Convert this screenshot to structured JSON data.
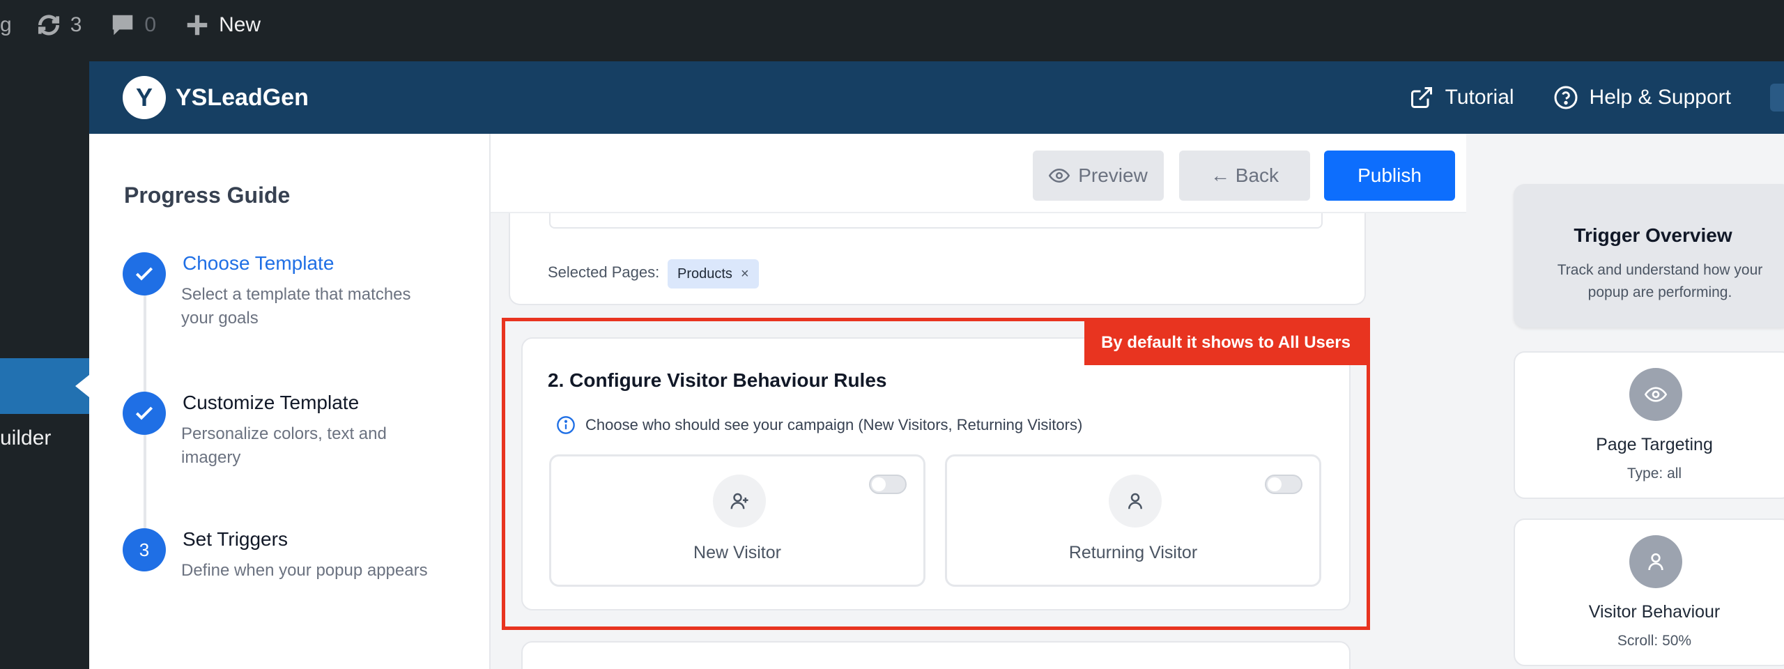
{
  "adminbar": {
    "site_fragment": "g",
    "updates_count": "3",
    "comments_count": "0",
    "new_label": "New"
  },
  "wpmenu": {
    "partial_label": "uilder"
  },
  "header": {
    "logo_letter": "Y",
    "brand": "YSLeadGen",
    "tutorial": "Tutorial",
    "help": "Help & Support"
  },
  "guide": {
    "title": "Progress Guide",
    "steps": [
      {
        "title": "Choose Template",
        "desc": "Select a template that matches your goals"
      },
      {
        "title": "Customize Template",
        "desc": "Personalize colors, text and imagery"
      },
      {
        "number": "3",
        "title": "Set Triggers",
        "desc": "Define when your popup appears"
      }
    ]
  },
  "toolbar": {
    "preview": "Preview",
    "back": "← Back",
    "publish": "Publish"
  },
  "pages": {
    "selected_label": "Selected Pages:",
    "chip": "Products",
    "chip_remove": "×"
  },
  "rules": {
    "annotation": "By default it shows to All Users",
    "title": "2. Configure Visitor Behaviour Rules",
    "info": "Choose who should see your campaign (New Visitors, Returning Visitors)",
    "new_visitor": "New Visitor",
    "returning_visitor": "Returning Visitor"
  },
  "overview": {
    "title": "Trigger Overview",
    "desc": "Track and understand how your popup are performing.",
    "cards": [
      {
        "title": "Page Targeting",
        "sub": "Type: all"
      },
      {
        "title": "Visitor Behaviour",
        "sub": "Scroll: 50%"
      }
    ]
  },
  "colors": {
    "brand_header": "#163f63",
    "primary": "#1f6fe5",
    "annotation_red": "#e83420"
  }
}
